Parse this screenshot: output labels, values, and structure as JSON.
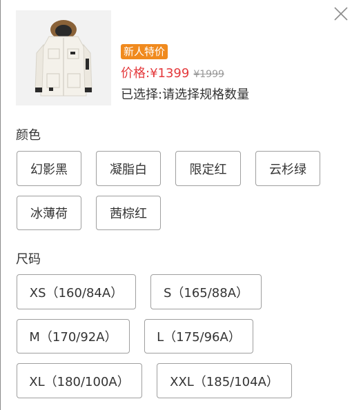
{
  "product": {
    "image_alt": "white down jacket with fur hood",
    "badge": "新人特价",
    "price_label": "价格:",
    "price_current": "¥1399",
    "price_original": "¥1999",
    "selected_label": "已选择:",
    "selected_value": "请选择规格数量"
  },
  "color_section": {
    "title": "颜色",
    "options": [
      "幻影黑",
      "凝脂白",
      "限定红",
      "云杉绿",
      "冰薄荷",
      "茜棕红"
    ]
  },
  "size_section": {
    "title": "尺码",
    "options": [
      "XS（160/84A）",
      "S（165/88A）",
      "M（170/92A）",
      "L（175/96A）",
      "XL（180/100A）",
      "XXL（185/104A）"
    ]
  },
  "icons": {
    "close": "close-icon"
  },
  "colors": {
    "badge_bg": "#f08a1e",
    "price": "#e4393c",
    "border": "#9e9e9e",
    "jacket": "#f4f1ea"
  }
}
